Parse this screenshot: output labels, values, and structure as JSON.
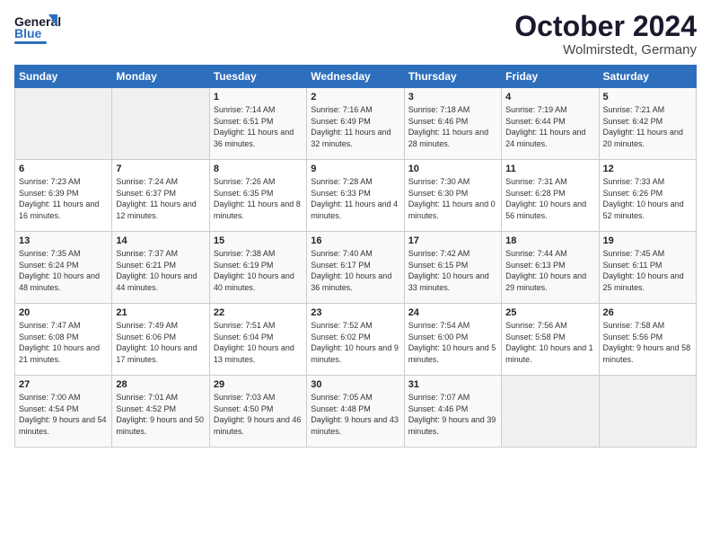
{
  "header": {
    "logo_general": "General",
    "logo_blue": "Blue",
    "title": "October 2024",
    "subtitle": "Wolmirstedt, Germany"
  },
  "days_of_week": [
    "Sunday",
    "Monday",
    "Tuesday",
    "Wednesday",
    "Thursday",
    "Friday",
    "Saturday"
  ],
  "weeks": [
    [
      {
        "num": "",
        "sunrise": "",
        "sunset": "",
        "daylight": ""
      },
      {
        "num": "",
        "sunrise": "",
        "sunset": "",
        "daylight": ""
      },
      {
        "num": "1",
        "sunrise": "Sunrise: 7:14 AM",
        "sunset": "Sunset: 6:51 PM",
        "daylight": "Daylight: 11 hours and 36 minutes."
      },
      {
        "num": "2",
        "sunrise": "Sunrise: 7:16 AM",
        "sunset": "Sunset: 6:49 PM",
        "daylight": "Daylight: 11 hours and 32 minutes."
      },
      {
        "num": "3",
        "sunrise": "Sunrise: 7:18 AM",
        "sunset": "Sunset: 6:46 PM",
        "daylight": "Daylight: 11 hours and 28 minutes."
      },
      {
        "num": "4",
        "sunrise": "Sunrise: 7:19 AM",
        "sunset": "Sunset: 6:44 PM",
        "daylight": "Daylight: 11 hours and 24 minutes."
      },
      {
        "num": "5",
        "sunrise": "Sunrise: 7:21 AM",
        "sunset": "Sunset: 6:42 PM",
        "daylight": "Daylight: 11 hours and 20 minutes."
      }
    ],
    [
      {
        "num": "6",
        "sunrise": "Sunrise: 7:23 AM",
        "sunset": "Sunset: 6:39 PM",
        "daylight": "Daylight: 11 hours and 16 minutes."
      },
      {
        "num": "7",
        "sunrise": "Sunrise: 7:24 AM",
        "sunset": "Sunset: 6:37 PM",
        "daylight": "Daylight: 11 hours and 12 minutes."
      },
      {
        "num": "8",
        "sunrise": "Sunrise: 7:26 AM",
        "sunset": "Sunset: 6:35 PM",
        "daylight": "Daylight: 11 hours and 8 minutes."
      },
      {
        "num": "9",
        "sunrise": "Sunrise: 7:28 AM",
        "sunset": "Sunset: 6:33 PM",
        "daylight": "Daylight: 11 hours and 4 minutes."
      },
      {
        "num": "10",
        "sunrise": "Sunrise: 7:30 AM",
        "sunset": "Sunset: 6:30 PM",
        "daylight": "Daylight: 11 hours and 0 minutes."
      },
      {
        "num": "11",
        "sunrise": "Sunrise: 7:31 AM",
        "sunset": "Sunset: 6:28 PM",
        "daylight": "Daylight: 10 hours and 56 minutes."
      },
      {
        "num": "12",
        "sunrise": "Sunrise: 7:33 AM",
        "sunset": "Sunset: 6:26 PM",
        "daylight": "Daylight: 10 hours and 52 minutes."
      }
    ],
    [
      {
        "num": "13",
        "sunrise": "Sunrise: 7:35 AM",
        "sunset": "Sunset: 6:24 PM",
        "daylight": "Daylight: 10 hours and 48 minutes."
      },
      {
        "num": "14",
        "sunrise": "Sunrise: 7:37 AM",
        "sunset": "Sunset: 6:21 PM",
        "daylight": "Daylight: 10 hours and 44 minutes."
      },
      {
        "num": "15",
        "sunrise": "Sunrise: 7:38 AM",
        "sunset": "Sunset: 6:19 PM",
        "daylight": "Daylight: 10 hours and 40 minutes."
      },
      {
        "num": "16",
        "sunrise": "Sunrise: 7:40 AM",
        "sunset": "Sunset: 6:17 PM",
        "daylight": "Daylight: 10 hours and 36 minutes."
      },
      {
        "num": "17",
        "sunrise": "Sunrise: 7:42 AM",
        "sunset": "Sunset: 6:15 PM",
        "daylight": "Daylight: 10 hours and 33 minutes."
      },
      {
        "num": "18",
        "sunrise": "Sunrise: 7:44 AM",
        "sunset": "Sunset: 6:13 PM",
        "daylight": "Daylight: 10 hours and 29 minutes."
      },
      {
        "num": "19",
        "sunrise": "Sunrise: 7:45 AM",
        "sunset": "Sunset: 6:11 PM",
        "daylight": "Daylight: 10 hours and 25 minutes."
      }
    ],
    [
      {
        "num": "20",
        "sunrise": "Sunrise: 7:47 AM",
        "sunset": "Sunset: 6:08 PM",
        "daylight": "Daylight: 10 hours and 21 minutes."
      },
      {
        "num": "21",
        "sunrise": "Sunrise: 7:49 AM",
        "sunset": "Sunset: 6:06 PM",
        "daylight": "Daylight: 10 hours and 17 minutes."
      },
      {
        "num": "22",
        "sunrise": "Sunrise: 7:51 AM",
        "sunset": "Sunset: 6:04 PM",
        "daylight": "Daylight: 10 hours and 13 minutes."
      },
      {
        "num": "23",
        "sunrise": "Sunrise: 7:52 AM",
        "sunset": "Sunset: 6:02 PM",
        "daylight": "Daylight: 10 hours and 9 minutes."
      },
      {
        "num": "24",
        "sunrise": "Sunrise: 7:54 AM",
        "sunset": "Sunset: 6:00 PM",
        "daylight": "Daylight: 10 hours and 5 minutes."
      },
      {
        "num": "25",
        "sunrise": "Sunrise: 7:56 AM",
        "sunset": "Sunset: 5:58 PM",
        "daylight": "Daylight: 10 hours and 1 minute."
      },
      {
        "num": "26",
        "sunrise": "Sunrise: 7:58 AM",
        "sunset": "Sunset: 5:56 PM",
        "daylight": "Daylight: 9 hours and 58 minutes."
      }
    ],
    [
      {
        "num": "27",
        "sunrise": "Sunrise: 7:00 AM",
        "sunset": "Sunset: 4:54 PM",
        "daylight": "Daylight: 9 hours and 54 minutes."
      },
      {
        "num": "28",
        "sunrise": "Sunrise: 7:01 AM",
        "sunset": "Sunset: 4:52 PM",
        "daylight": "Daylight: 9 hours and 50 minutes."
      },
      {
        "num": "29",
        "sunrise": "Sunrise: 7:03 AM",
        "sunset": "Sunset: 4:50 PM",
        "daylight": "Daylight: 9 hours and 46 minutes."
      },
      {
        "num": "30",
        "sunrise": "Sunrise: 7:05 AM",
        "sunset": "Sunset: 4:48 PM",
        "daylight": "Daylight: 9 hours and 43 minutes."
      },
      {
        "num": "31",
        "sunrise": "Sunrise: 7:07 AM",
        "sunset": "Sunset: 4:46 PM",
        "daylight": "Daylight: 9 hours and 39 minutes."
      },
      {
        "num": "",
        "sunrise": "",
        "sunset": "",
        "daylight": ""
      },
      {
        "num": "",
        "sunrise": "",
        "sunset": "",
        "daylight": ""
      }
    ]
  ]
}
